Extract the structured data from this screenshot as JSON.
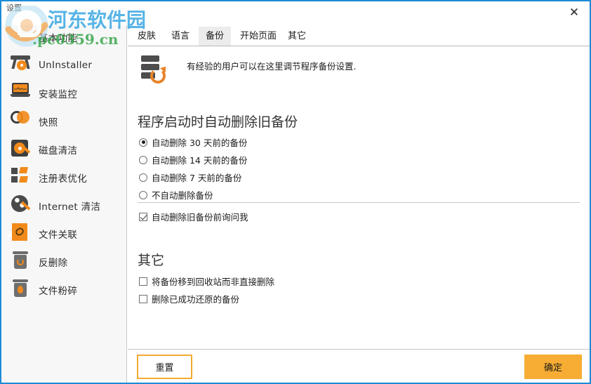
{
  "window": {
    "title": "设置",
    "close_label": "✕",
    "border_color": "#1e8ad6"
  },
  "watermark": {
    "brand_text": "河东软件园",
    "url_text": ".pc0359.cn",
    "brand_color": "#2a9fe0",
    "url_color": "#2aa03f"
  },
  "sidebar": {
    "items": [
      {
        "label": "基本功能",
        "icon": "gear-icon"
      },
      {
        "label": "UnInstaller",
        "icon": "uninstaller-icon"
      },
      {
        "label": "安装监控",
        "icon": "install-monitor-icon"
      },
      {
        "label": "快照",
        "icon": "snapshot-icon"
      },
      {
        "label": "磁盘清洁",
        "icon": "disk-clean-icon"
      },
      {
        "label": "注册表优化",
        "icon": "registry-optimize-icon"
      },
      {
        "label": "Internet 清洁",
        "icon": "internet-clean-icon"
      },
      {
        "label": "文件关联",
        "icon": "file-association-icon"
      },
      {
        "label": "反删除",
        "icon": "undelete-icon"
      },
      {
        "label": "文件粉碎",
        "icon": "file-shredder-icon"
      }
    ]
  },
  "tabs": {
    "items": [
      {
        "label": "皮肤",
        "active": false
      },
      {
        "label": "语言",
        "active": false
      },
      {
        "label": "备份",
        "active": true
      },
      {
        "label": "开始页面",
        "active": false
      },
      {
        "label": "其它",
        "active": false
      }
    ],
    "active_bg": "#ececec"
  },
  "main": {
    "header_icon": "database-restore-icon",
    "header_text": "有经验的用户可以在这里调节程序备份设置.",
    "section_auto_delete": {
      "title": "程序启动时自动删除旧备份",
      "options": [
        {
          "label": "自动删除 30 天前的备份",
          "selected": true
        },
        {
          "label": "自动删除 14 天前的备份",
          "selected": false
        },
        {
          "label": "自动删除 7 天前的备份",
          "selected": false
        },
        {
          "label": "不自动删除备份",
          "selected": false
        }
      ],
      "confirm_checkbox": {
        "label": "自动删除旧备份前询问我",
        "checked": true
      }
    },
    "section_other": {
      "title": "其它",
      "checkboxes": [
        {
          "label": "将备份移到回收站而非直接删除",
          "checked": false
        },
        {
          "label": "删除已成功还原的备份",
          "checked": false
        }
      ]
    }
  },
  "footer": {
    "reset_label": "重置",
    "ok_label": "确定",
    "accent_color": "#f7ad33"
  }
}
